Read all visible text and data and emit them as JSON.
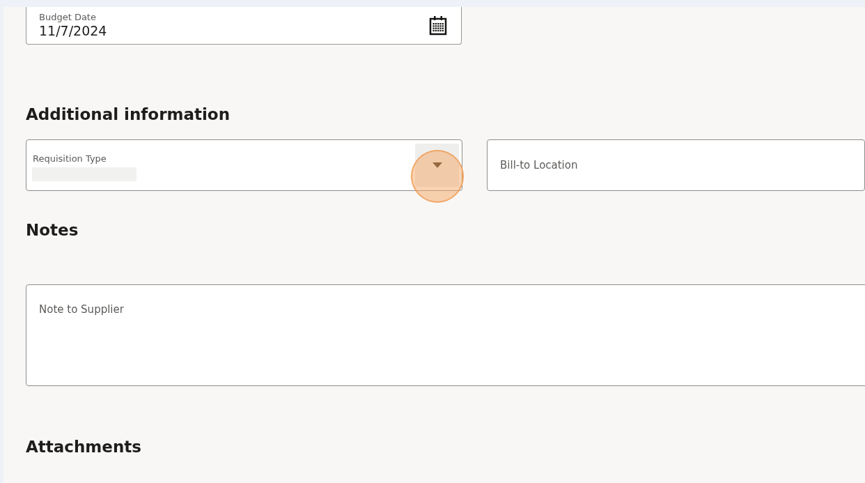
{
  "budget_date": {
    "label": "Budget Date",
    "value": "11/7/2024"
  },
  "additional_information": {
    "heading": "Additional information",
    "requisition_type": {
      "label": "Requisition Type"
    },
    "bill_to_location": {
      "placeholder": "Bill-to Location"
    }
  },
  "notes": {
    "heading": "Notes",
    "note_to_supplier": {
      "placeholder": "Note to Supplier"
    }
  },
  "attachments": {
    "heading": "Attachments"
  }
}
